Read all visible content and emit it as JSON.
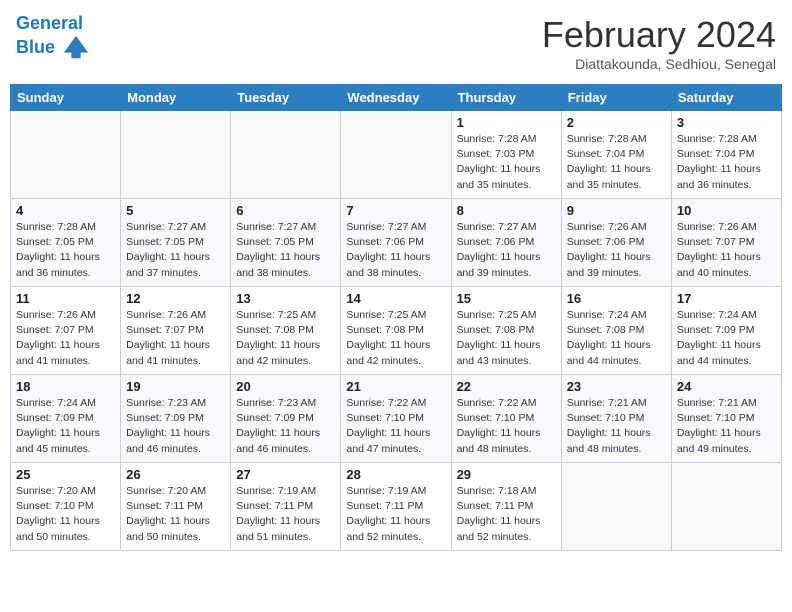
{
  "header": {
    "logo_line1": "General",
    "logo_line2": "Blue",
    "title": "February 2024",
    "subtitle": "Diattakounda, Sedhiou, Senegal"
  },
  "weekdays": [
    "Sunday",
    "Monday",
    "Tuesday",
    "Wednesday",
    "Thursday",
    "Friday",
    "Saturday"
  ],
  "weeks": [
    [
      {
        "day": "",
        "info": ""
      },
      {
        "day": "",
        "info": ""
      },
      {
        "day": "",
        "info": ""
      },
      {
        "day": "",
        "info": ""
      },
      {
        "day": "1",
        "info": "Sunrise: 7:28 AM\nSunset: 7:03 PM\nDaylight: 11 hours\nand 35 minutes."
      },
      {
        "day": "2",
        "info": "Sunrise: 7:28 AM\nSunset: 7:04 PM\nDaylight: 11 hours\nand 35 minutes."
      },
      {
        "day": "3",
        "info": "Sunrise: 7:28 AM\nSunset: 7:04 PM\nDaylight: 11 hours\nand 36 minutes."
      }
    ],
    [
      {
        "day": "4",
        "info": "Sunrise: 7:28 AM\nSunset: 7:05 PM\nDaylight: 11 hours\nand 36 minutes."
      },
      {
        "day": "5",
        "info": "Sunrise: 7:27 AM\nSunset: 7:05 PM\nDaylight: 11 hours\nand 37 minutes."
      },
      {
        "day": "6",
        "info": "Sunrise: 7:27 AM\nSunset: 7:05 PM\nDaylight: 11 hours\nand 38 minutes."
      },
      {
        "day": "7",
        "info": "Sunrise: 7:27 AM\nSunset: 7:06 PM\nDaylight: 11 hours\nand 38 minutes."
      },
      {
        "day": "8",
        "info": "Sunrise: 7:27 AM\nSunset: 7:06 PM\nDaylight: 11 hours\nand 39 minutes."
      },
      {
        "day": "9",
        "info": "Sunrise: 7:26 AM\nSunset: 7:06 PM\nDaylight: 11 hours\nand 39 minutes."
      },
      {
        "day": "10",
        "info": "Sunrise: 7:26 AM\nSunset: 7:07 PM\nDaylight: 11 hours\nand 40 minutes."
      }
    ],
    [
      {
        "day": "11",
        "info": "Sunrise: 7:26 AM\nSunset: 7:07 PM\nDaylight: 11 hours\nand 41 minutes."
      },
      {
        "day": "12",
        "info": "Sunrise: 7:26 AM\nSunset: 7:07 PM\nDaylight: 11 hours\nand 41 minutes."
      },
      {
        "day": "13",
        "info": "Sunrise: 7:25 AM\nSunset: 7:08 PM\nDaylight: 11 hours\nand 42 minutes."
      },
      {
        "day": "14",
        "info": "Sunrise: 7:25 AM\nSunset: 7:08 PM\nDaylight: 11 hours\nand 42 minutes."
      },
      {
        "day": "15",
        "info": "Sunrise: 7:25 AM\nSunset: 7:08 PM\nDaylight: 11 hours\nand 43 minutes."
      },
      {
        "day": "16",
        "info": "Sunrise: 7:24 AM\nSunset: 7:08 PM\nDaylight: 11 hours\nand 44 minutes."
      },
      {
        "day": "17",
        "info": "Sunrise: 7:24 AM\nSunset: 7:09 PM\nDaylight: 11 hours\nand 44 minutes."
      }
    ],
    [
      {
        "day": "18",
        "info": "Sunrise: 7:24 AM\nSunset: 7:09 PM\nDaylight: 11 hours\nand 45 minutes."
      },
      {
        "day": "19",
        "info": "Sunrise: 7:23 AM\nSunset: 7:09 PM\nDaylight: 11 hours\nand 46 minutes."
      },
      {
        "day": "20",
        "info": "Sunrise: 7:23 AM\nSunset: 7:09 PM\nDaylight: 11 hours\nand 46 minutes."
      },
      {
        "day": "21",
        "info": "Sunrise: 7:22 AM\nSunset: 7:10 PM\nDaylight: 11 hours\nand 47 minutes."
      },
      {
        "day": "22",
        "info": "Sunrise: 7:22 AM\nSunset: 7:10 PM\nDaylight: 11 hours\nand 48 minutes."
      },
      {
        "day": "23",
        "info": "Sunrise: 7:21 AM\nSunset: 7:10 PM\nDaylight: 11 hours\nand 48 minutes."
      },
      {
        "day": "24",
        "info": "Sunrise: 7:21 AM\nSunset: 7:10 PM\nDaylight: 11 hours\nand 49 minutes."
      }
    ],
    [
      {
        "day": "25",
        "info": "Sunrise: 7:20 AM\nSunset: 7:10 PM\nDaylight: 11 hours\nand 50 minutes."
      },
      {
        "day": "26",
        "info": "Sunrise: 7:20 AM\nSunset: 7:11 PM\nDaylight: 11 hours\nand 50 minutes."
      },
      {
        "day": "27",
        "info": "Sunrise: 7:19 AM\nSunset: 7:11 PM\nDaylight: 11 hours\nand 51 minutes."
      },
      {
        "day": "28",
        "info": "Sunrise: 7:19 AM\nSunset: 7:11 PM\nDaylight: 11 hours\nand 52 minutes."
      },
      {
        "day": "29",
        "info": "Sunrise: 7:18 AM\nSunset: 7:11 PM\nDaylight: 11 hours\nand 52 minutes."
      },
      {
        "day": "",
        "info": ""
      },
      {
        "day": "",
        "info": ""
      }
    ]
  ]
}
